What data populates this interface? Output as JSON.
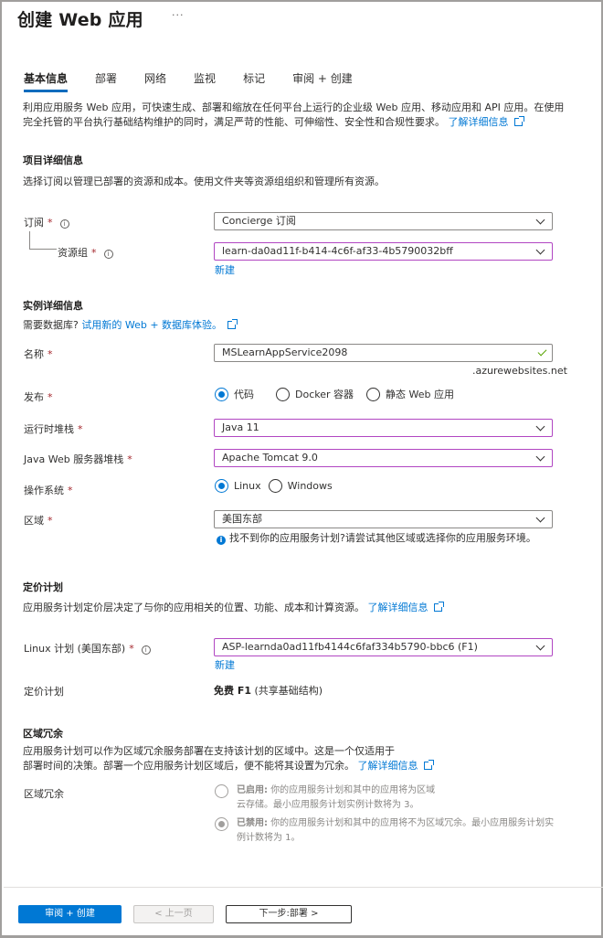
{
  "header": {
    "title": "创建 Web 应用",
    "more_label": "···"
  },
  "tabs": [
    {
      "label": "基本信息",
      "active": true
    },
    {
      "label": "部署",
      "active": false
    },
    {
      "label": "网络",
      "active": false
    },
    {
      "label": "监视",
      "active": false
    },
    {
      "label": "标记",
      "active": false
    },
    {
      "label": "审阅 + 创建",
      "active": false
    }
  ],
  "intro": {
    "text": "利用应用服务 Web 应用，可快速生成、部署和缩放在任何平台上运行的企业级 Web 应用、移动应用和 API 应用。在使用完全托管的平台执行基础结构维护的同时，满足严苛的性能、可伸缩性、安全性和合规性要求。",
    "link": "了解详细信息"
  },
  "project_details": {
    "heading": "项目详细信息",
    "description": "选择订阅以管理已部署的资源和成本。使用文件夹等资源组组织和管理所有资源。",
    "subscription": {
      "label": "订阅",
      "required": "*",
      "value": "Concierge 订阅"
    },
    "resource_group": {
      "label": "资源组",
      "required": "*",
      "value": "learn-da0ad11f-b414-4c6f-af33-4b5790032bff",
      "new_link": "新建"
    }
  },
  "instance_details": {
    "heading": "实例详细信息",
    "db_prompt": "需要数据库?",
    "db_link": "试用新的 Web + 数据库体验。",
    "name": {
      "label": "名称",
      "required": "*",
      "value": "MSLearnAppService2098",
      "suffix": ".azurewebsites.net",
      "valid": true
    },
    "publish": {
      "label": "发布",
      "required": "*",
      "options": [
        {
          "label": "代码",
          "selected": true
        },
        {
          "label": "Docker 容器",
          "selected": false
        },
        {
          "label": "静态 Web 应用",
          "selected": false
        }
      ]
    },
    "runtime_stack": {
      "label": "运行时堆栈",
      "required": "*",
      "value": "Java 11"
    },
    "java_web_server": {
      "label": "Java Web 服务器堆栈",
      "required": "*",
      "value": "Apache Tomcat 9.0"
    },
    "os": {
      "label": "操作系统",
      "required": "*",
      "options": [
        {
          "label": "Linux",
          "selected": true
        },
        {
          "label": "Windows",
          "selected": false
        }
      ]
    },
    "region": {
      "label": "区域",
      "required": "*",
      "value": "美国东部",
      "hint": "找不到你的应用服务计划?请尝试其他区域或选择你的应用服务环境。"
    }
  },
  "pricing": {
    "heading": "定价计划",
    "description": "应用服务计划定价层决定了与你的应用相关的位置、功能、成本和计算资源。",
    "link": "了解详细信息",
    "linux_plan": {
      "label": "Linux 计划 (美国东部)",
      "required": "*",
      "value": "ASP-learnda0ad11fb4144c6faf334b5790-bbc6 (F1)",
      "new_link": "新建"
    },
    "plan": {
      "label": "定价计划",
      "tier_bold": "免费 F1",
      "tier_rest": "(共享基础结构)"
    }
  },
  "zone_redundancy": {
    "heading": "区域冗余",
    "description_line1": "应用服务计划可以作为区域冗余服务部署在支持该计划的区域中。这是一个仅适用于",
    "description_line2": "部署时间的决策。部署一个应用服务计划区域后，便不能将其设置为冗余。",
    "link": "了解详细信息",
    "label": "区域冗余",
    "options": [
      {
        "title": "已启用:",
        "line1": "你的应用服务计划和其中的应用将为区域",
        "line2": "云存储。最小应用服务计划实例计数将为 3。",
        "selected": false
      },
      {
        "title": "已禁用:",
        "line1": "你的应用服务计划和其中的应用将不为区域冗余。最小应用服务计划实",
        "line2": "例计数将为 1。",
        "selected": true
      }
    ]
  },
  "footer": {
    "review_create": "审阅 + 创建",
    "previous": "< 上一页",
    "next": "下一步:部署 >"
  },
  "colors": {
    "accent": "#0078d4",
    "required": "#a4262c",
    "focus_border": "#b146c2",
    "valid": "#57a300"
  }
}
